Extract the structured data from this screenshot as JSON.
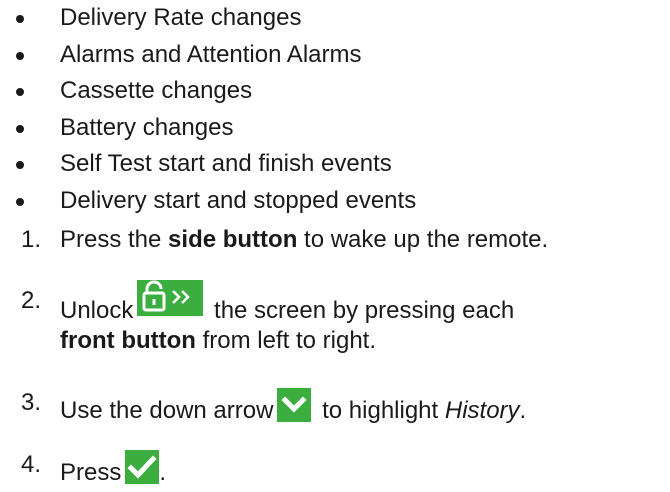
{
  "bullets": [
    "Delivery Rate changes",
    "Alarms and Attention Alarms",
    "Cassette changes",
    "Battery changes",
    "Self Test start and finish events",
    "Delivery start and stopped events"
  ],
  "steps": {
    "s1": {
      "num": "1.",
      "pre": "Press the ",
      "bold": "side button",
      "post": " to wake up the remote."
    },
    "s2": {
      "num": "2.",
      "pre": "Unlock",
      "post": " the screen by pressing each",
      "bold": "front button",
      "post2": " from left to right."
    },
    "s3": {
      "num": "3.",
      "pre": "Use the down arrow",
      "post": " to highlight ",
      "italic": "History",
      "end": "."
    },
    "s4": {
      "num": "4.",
      "pre": "Press",
      "end": "."
    }
  },
  "icons": {
    "unlock": "unlock-chevron-icon",
    "down": "chevron-down-icon",
    "check": "checkmark-icon"
  },
  "colors": {
    "icon_bg": "#3cae40",
    "icon_fg": "#ffffff",
    "text": "#1a1a1a"
  }
}
